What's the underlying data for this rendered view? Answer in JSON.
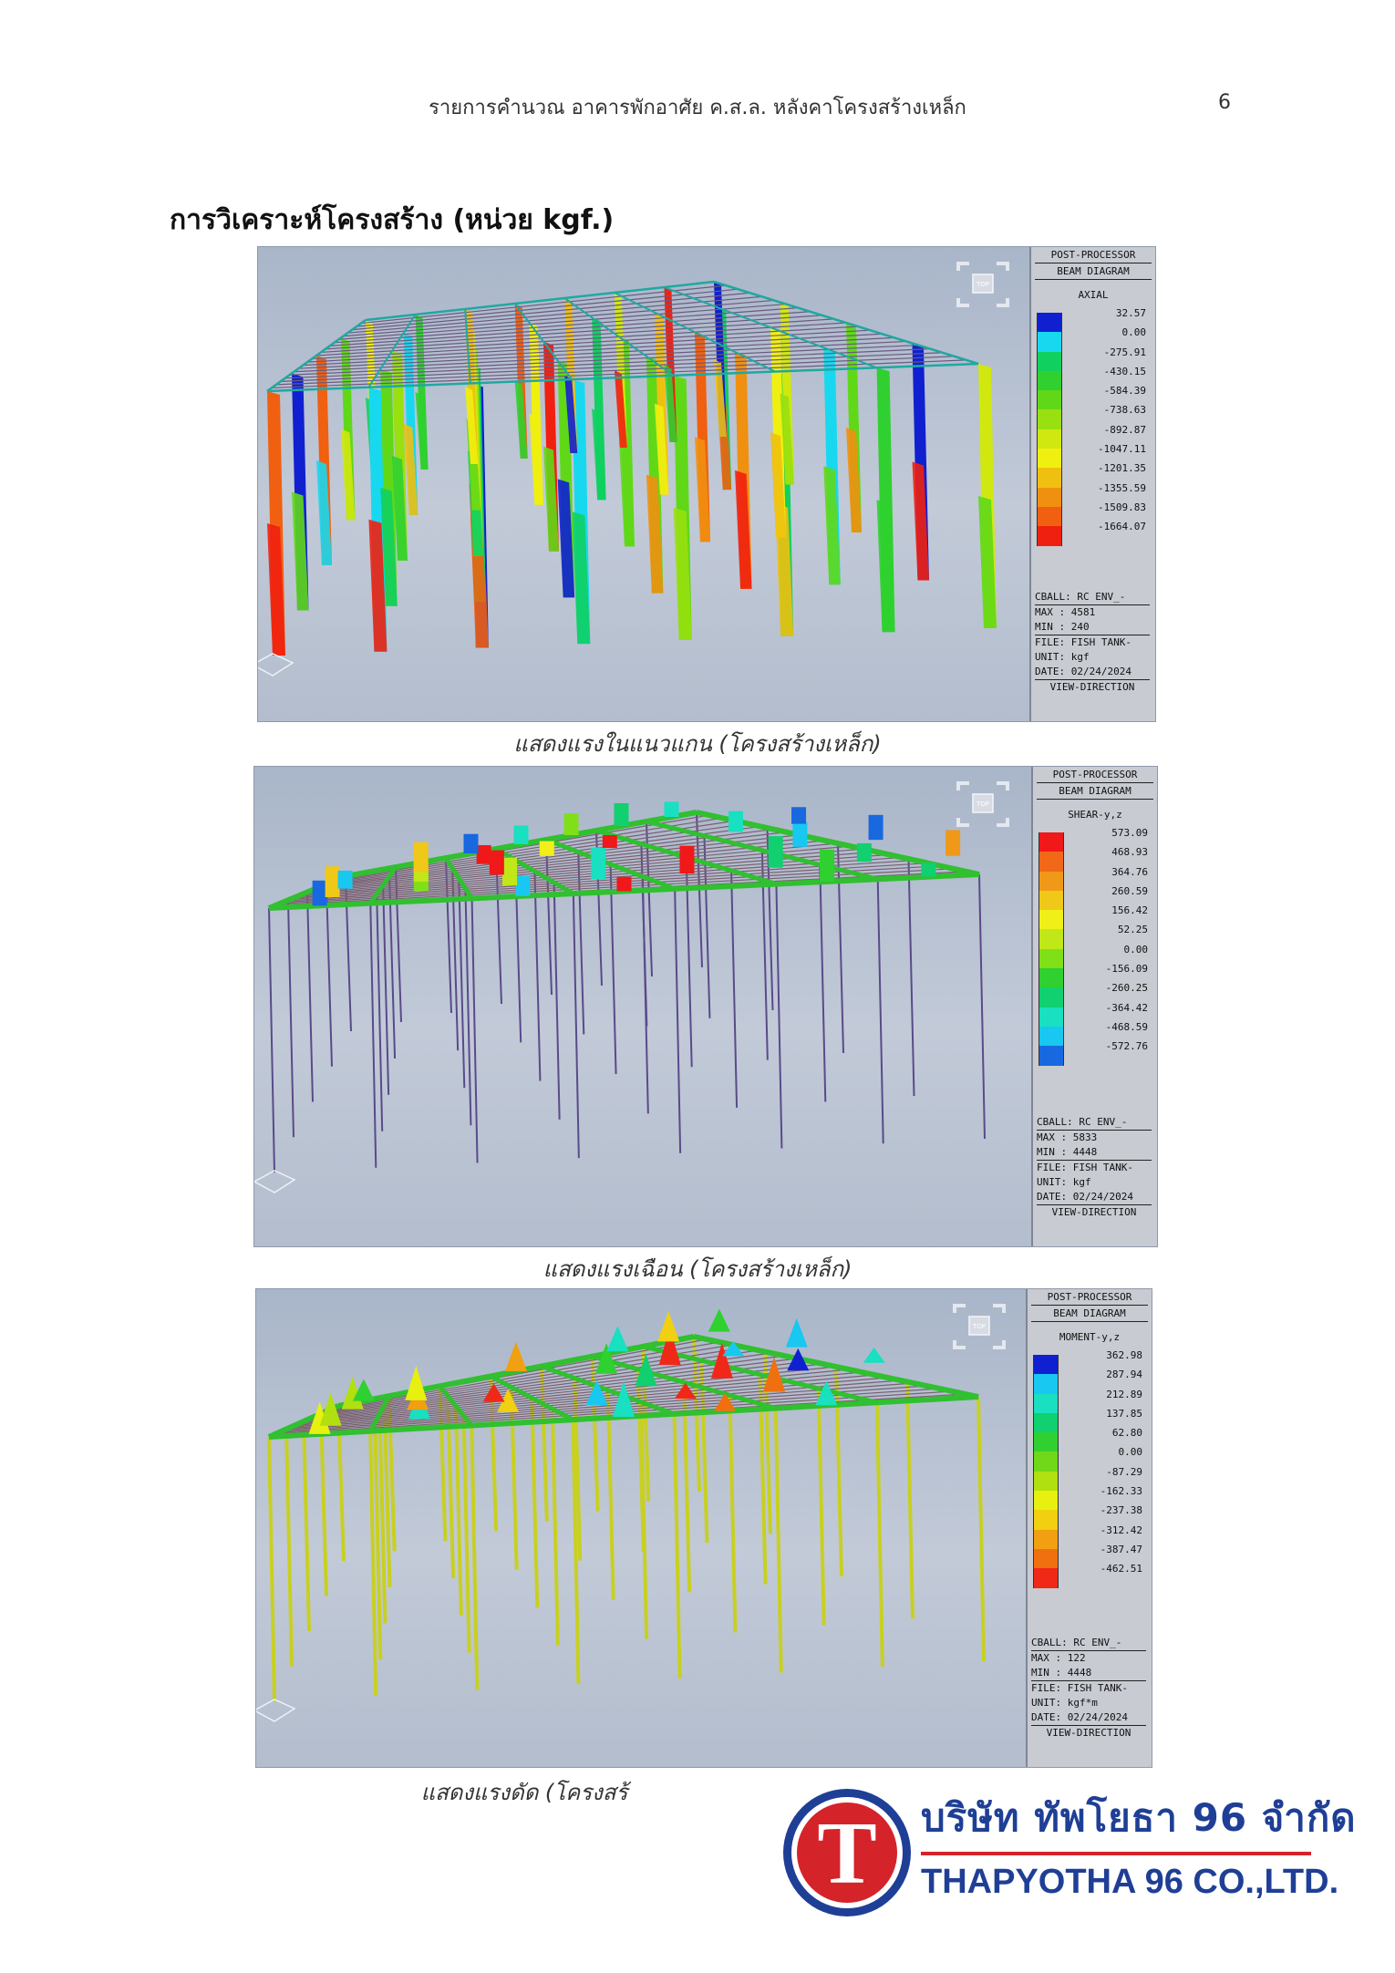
{
  "header": {
    "running_title": "รายการคำนวณ อาคารพักอาศัย ค.ส.ล. หลังคาโครงสร้างเหล็ก",
    "page_number": "6"
  },
  "section_heading": "การวิเคราะห์โครงสร้าง (หน่วย kgf.)",
  "figures": [
    {
      "caption": "แสดงแรงในแนวแกน (โครงสร้างเหล็ก)",
      "panel": {
        "title1": "POST-PROCESSOR",
        "title2": "BEAM DIAGRAM",
        "diagram_type": "AXIAL",
        "legend_values": [
          "32.57",
          "0.00",
          "-275.91",
          "-430.15",
          "-584.39",
          "-738.63",
          "-892.87",
          "-1047.11",
          "-1201.35",
          "-1355.59",
          "-1509.83",
          "-1664.07"
        ],
        "legend_colors": [
          "#1020d0",
          "#18d8f0",
          "#10d060",
          "#30d030",
          "#60d818",
          "#98e010",
          "#d0e810",
          "#f0f010",
          "#f0c010",
          "#f09010",
          "#f06010",
          "#f02010"
        ],
        "cball": "CBALL: RC ENV_-",
        "max": "MAX : 4581",
        "min": "MIN : 240",
        "file": "FILE: FISH TANK-",
        "unit": "UNIT: kgf",
        "date": "DATE: 02/24/2024",
        "view": "VIEW-DIRECTION"
      }
    },
    {
      "caption": "แสดงแรงเฉือน (โครงสร้างเหล็ก)",
      "panel": {
        "title1": "POST-PROCESSOR",
        "title2": "BEAM DIAGRAM",
        "diagram_type": "SHEAR-y,z",
        "legend_values": [
          "573.09",
          "468.93",
          "364.76",
          "260.59",
          "156.42",
          "52.25",
          "0.00",
          "-156.09",
          "-260.25",
          "-364.42",
          "-468.59",
          "-572.76"
        ],
        "legend_colors": [
          "#f01818",
          "#f06818",
          "#f09818",
          "#f0c818",
          "#f0f018",
          "#c0e818",
          "#80e018",
          "#30d030",
          "#10d070",
          "#18e0c0",
          "#18c8f0",
          "#1868e0"
        ],
        "cball": "CBALL: RC ENV_-",
        "max": "MAX : 5833",
        "min": "MIN : 4448",
        "file": "FILE: FISH TANK-",
        "unit": "UNIT: kgf",
        "date": "DATE: 02/24/2024",
        "view": "VIEW-DIRECTION"
      }
    },
    {
      "caption": "แสดงแรงดัด (โครงสร้",
      "panel": {
        "title1": "POST-PROCESSOR",
        "title2": "BEAM DIAGRAM",
        "diagram_type": "MOMENT-y,z",
        "legend_values": [
          "362.98",
          "287.94",
          "212.89",
          "137.85",
          "62.80",
          "0.00",
          "-87.29",
          "-162.33",
          "-237.38",
          "-312.42",
          "-387.47",
          "-462.51"
        ],
        "legend_colors": [
          "#1020d0",
          "#18c8f0",
          "#18e0c0",
          "#10d070",
          "#30d030",
          "#70d818",
          "#b0e010",
          "#e8f010",
          "#f0d010",
          "#f0a010",
          "#f07010",
          "#f02818"
        ],
        "cball": "CBALL: RC ENV_-",
        "max": "MAX : 122",
        "min": "MIN : 4448",
        "file": "FILE: FISH TANK-",
        "unit": "UNIT: kgf*m",
        "date": "DATE: 02/24/2024",
        "view": "VIEW-DIRECTION"
      }
    }
  ],
  "nav_cube_label": "TOP",
  "logo": {
    "letter": "T",
    "name_th": "บริษัท ทัพโยธา 96 จำกัด",
    "name_en": "THAPYOTHA 96 CO.,LTD.",
    "colors": {
      "blue": "#1f3f96",
      "red": "#d5232a"
    }
  }
}
